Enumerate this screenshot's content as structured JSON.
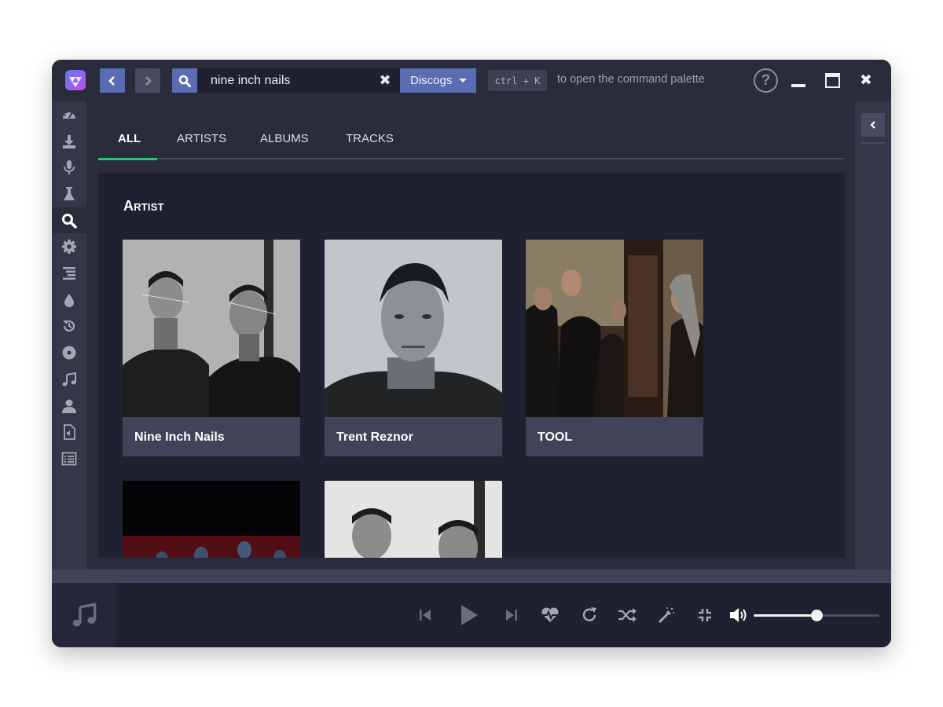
{
  "titlebar": {
    "search_value": "nine inch nails",
    "source": "Discogs",
    "shortcut": "ctrl + K",
    "shortcut_hint": "to open the command palette",
    "help": "?"
  },
  "sidebar": {
    "items": [
      {
        "icon": "dashboard-icon"
      },
      {
        "icon": "download-icon"
      },
      {
        "icon": "microphone-icon"
      },
      {
        "icon": "flask-icon"
      },
      {
        "icon": "search-icon",
        "active": true
      },
      {
        "icon": "gear-icon"
      },
      {
        "icon": "queue-icon"
      },
      {
        "icon": "drop-icon"
      },
      {
        "icon": "history-icon"
      },
      {
        "icon": "disc-icon"
      },
      {
        "icon": "music-note-icon"
      },
      {
        "icon": "user-icon"
      },
      {
        "icon": "audio-file-icon"
      },
      {
        "icon": "list-icon"
      }
    ]
  },
  "tabs": [
    {
      "label": "ALL",
      "active": true
    },
    {
      "label": "ARTISTS"
    },
    {
      "label": "ALBUMS"
    },
    {
      "label": "TRACKS"
    }
  ],
  "results": {
    "section_title": "Artist",
    "artists": [
      {
        "name": "Nine Inch Nails"
      },
      {
        "name": "Trent Reznor"
      },
      {
        "name": "TOOL"
      }
    ]
  },
  "player": {
    "volume": 0.5
  },
  "colors": {
    "accent": "#5a6cb2",
    "tab_indicator": "#2ec27e",
    "window_bg": "#2a2b3b",
    "panel_bg": "#1f2030"
  }
}
